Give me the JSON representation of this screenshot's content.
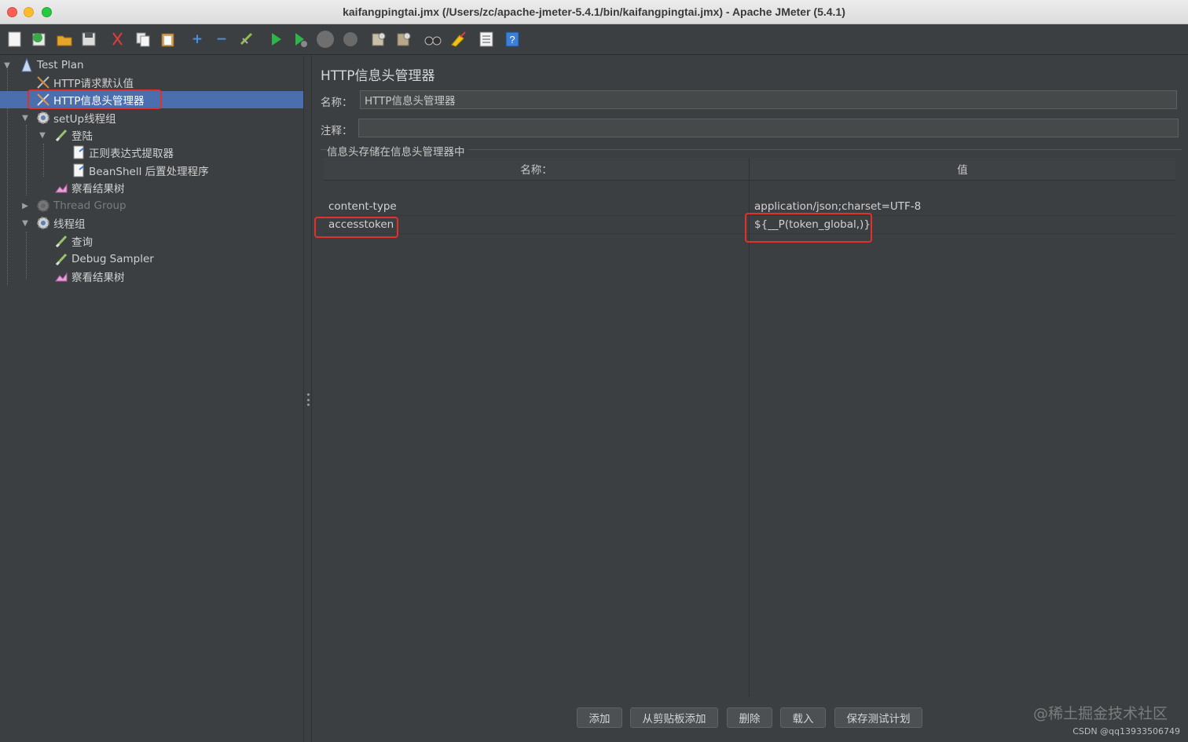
{
  "window": {
    "title": "kaifangpingtai.jmx (/Users/zc/apache-jmeter-5.4.1/bin/kaifangpingtai.jmx) - Apache JMeter (5.4.1)"
  },
  "toolbar": {
    "icons": [
      "new-icon",
      "templates-icon",
      "open-icon",
      "save-icon",
      "cut-icon",
      "copy-icon",
      "paste-icon",
      "expand-icon",
      "collapse-icon",
      "toggle-icon",
      "start-icon",
      "start-no-pause-icon",
      "stop-icon",
      "shutdown-icon",
      "clear-icon",
      "clear-all-icon",
      "search-icon",
      "reset-search-icon",
      "function-helper-icon",
      "help-icon"
    ]
  },
  "tree": {
    "items": [
      {
        "label": "Test Plan",
        "icon": "test-plan-icon"
      },
      {
        "label": "HTTP请求默认值",
        "icon": "config-icon"
      },
      {
        "label": "HTTP信息头管理器",
        "icon": "config-icon"
      },
      {
        "label": "setUp线程组",
        "icon": "gear-icon"
      },
      {
        "label": "登陆",
        "icon": "sampler-icon"
      },
      {
        "label": "正则表达式提取器",
        "icon": "postprocessor-icon"
      },
      {
        "label": "BeanShell 后置处理程序",
        "icon": "postprocessor-icon"
      },
      {
        "label": "察看结果树",
        "icon": "listener-icon"
      },
      {
        "label": "Thread Group",
        "icon": "gear-icon"
      },
      {
        "label": "线程组",
        "icon": "gear-icon"
      },
      {
        "label": "查询",
        "icon": "sampler-icon"
      },
      {
        "label": "Debug Sampler",
        "icon": "sampler-icon"
      },
      {
        "label": "察看结果树",
        "icon": "listener-icon"
      }
    ]
  },
  "panel": {
    "title": "HTTP信息头管理器",
    "name_label": "名称：",
    "name_value": "HTTP信息头管理器",
    "comment_label": "注释：",
    "comment_value": "",
    "group_label": "信息头存储在信息头管理器中",
    "table": {
      "headers": [
        "名称：",
        "值"
      ],
      "rows": [
        {
          "name": "content-type",
          "value": "application/json;charset=UTF-8"
        },
        {
          "name": "accesstoken",
          "value": "${__P(token_global,)}"
        }
      ]
    },
    "buttons": {
      "add": "添加",
      "add_from_clipboard": "从剪贴板添加",
      "delete": "删除",
      "load": "载入",
      "save_test_plan": "保存测试计划"
    }
  },
  "watermark": {
    "main": "@稀土掘金技术社区",
    "sub": "CSDN @qq13933506749"
  },
  "colors": {
    "background": "#3c3f41",
    "selection": "#4b6eaf",
    "highlight": "#e0322b"
  }
}
